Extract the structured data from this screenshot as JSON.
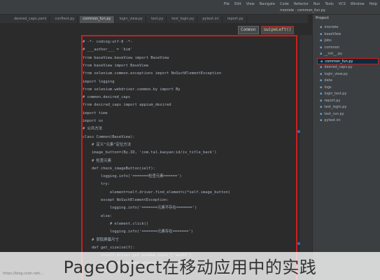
{
  "menu": [
    "File",
    "Edit",
    "View",
    "Navigate",
    "Code",
    "Refactor",
    "Run",
    "Tools",
    "VCS",
    "Window",
    "Help"
  ],
  "toolbar": {
    "breadcrumb": "moniele · common_fun.py"
  },
  "tabs": [
    {
      "label": "desired_caps.yaml",
      "active": false
    },
    {
      "label": "conftest.py",
      "active": false
    },
    {
      "label": "common_fun.py",
      "active": true
    },
    {
      "label": "login_view.py",
      "active": false
    },
    {
      "label": "test.py",
      "active": false
    },
    {
      "label": "test_login.py",
      "active": false
    },
    {
      "label": "pytest.ini",
      "active": false
    },
    {
      "label": "report.py",
      "active": false
    }
  ],
  "editor_head": {
    "class_chip": "Common",
    "method_chip": "swipeLeft()"
  },
  "code_lines": [
    {
      "n": "1",
      "text": "# -*- coding:utf-8 -*-"
    },
    {
      "n": "2",
      "text": "# ___author___ = 'kim'"
    },
    {
      "n": "3",
      "text": "from baseView.baseView import BaseView"
    },
    {
      "n": "4",
      "text": "from baseView import BaseView"
    },
    {
      "n": "5",
      "text": "from selenium.common.exceptions import NoSuchElementException"
    },
    {
      "n": "6",
      "text": "import logging"
    },
    {
      "n": "7",
      "text": "from selenium.webdriver.common.by import By"
    },
    {
      "n": "8",
      "text": "# common.desired_caps"
    },
    {
      "n": "9",
      "text": "from desired_caps import appium_desired"
    },
    {
      "n": "10",
      "text": "import time"
    },
    {
      "n": "11",
      "text": "import os"
    },
    {
      "n": "12",
      "text": "# 公共方法"
    },
    {
      "n": "13",
      "text": "class Common(BaseView):"
    },
    {
      "n": "14",
      "text": "    # 定义\"元素\"定位方法"
    },
    {
      "n": "15",
      "text": "    image_button=(By.ID, 'com.tal.kaoyan:id/iv_title_back')"
    },
    {
      "n": "16",
      "text": "    # 检查元素"
    },
    {
      "n": "17",
      "text": "    def check_imageButton(self):"
    },
    {
      "n": "18",
      "text": "        logging.info('=======检查元素======')"
    },
    {
      "n": "19",
      "text": "        try:"
    },
    {
      "n": "20",
      "text": "            element=self.driver.find_elements(*self.image_button)"
    },
    {
      "n": "21",
      "text": "        except NoSuchElementException:"
    },
    {
      "n": "22",
      "text": "            logging.info('=======元素不存在=======')"
    },
    {
      "n": "23",
      "text": "        else:"
    },
    {
      "n": "24",
      "text": "            # element.click()"
    },
    {
      "n": "25",
      "text": "            logging.info('=======元素存在=======')"
    },
    {
      "n": "26",
      "text": "    # 获取屏幕尺寸"
    },
    {
      "n": "27",
      "text": "    def get_size(self):"
    },
    {
      "n": "28",
      "text": "        x=self.driver.get_window_size()['width']"
    },
    {
      "n": "29",
      "text": "        y=self.driver.get_window_size()['height']"
    },
    {
      "n": "30",
      "text": "        return (x, y)"
    }
  ],
  "sidebar": {
    "title": "Project",
    "items": [
      {
        "label": "moniele",
        "selected": false
      },
      {
        "label": "baseView",
        "selected": false
      },
      {
        "label": "Jobs",
        "selected": false
      },
      {
        "label": "common",
        "selected": false
      },
      {
        "label": "__init__.py",
        "selected": false
      },
      {
        "label": "common_fun.py",
        "selected": true
      },
      {
        "label": "desired_caps.py",
        "selected": false
      },
      {
        "label": "login_view.py",
        "selected": false
      },
      {
        "label": "data",
        "selected": false
      },
      {
        "label": "logs",
        "selected": false
      },
      {
        "label": "login_test.py",
        "selected": false
      },
      {
        "label": "report.py",
        "selected": false
      },
      {
        "label": "test_login.py",
        "selected": false
      },
      {
        "label": "test_run.py",
        "selected": false
      },
      {
        "label": "pytest.ini",
        "selected": false
      }
    ]
  },
  "caption": "PageObject在移动应用中的实践",
  "watermark": "https://blog.csdn.net/...",
  "colors": {
    "highlight": "#cc1e1e",
    "background": "#2b2b2b"
  }
}
